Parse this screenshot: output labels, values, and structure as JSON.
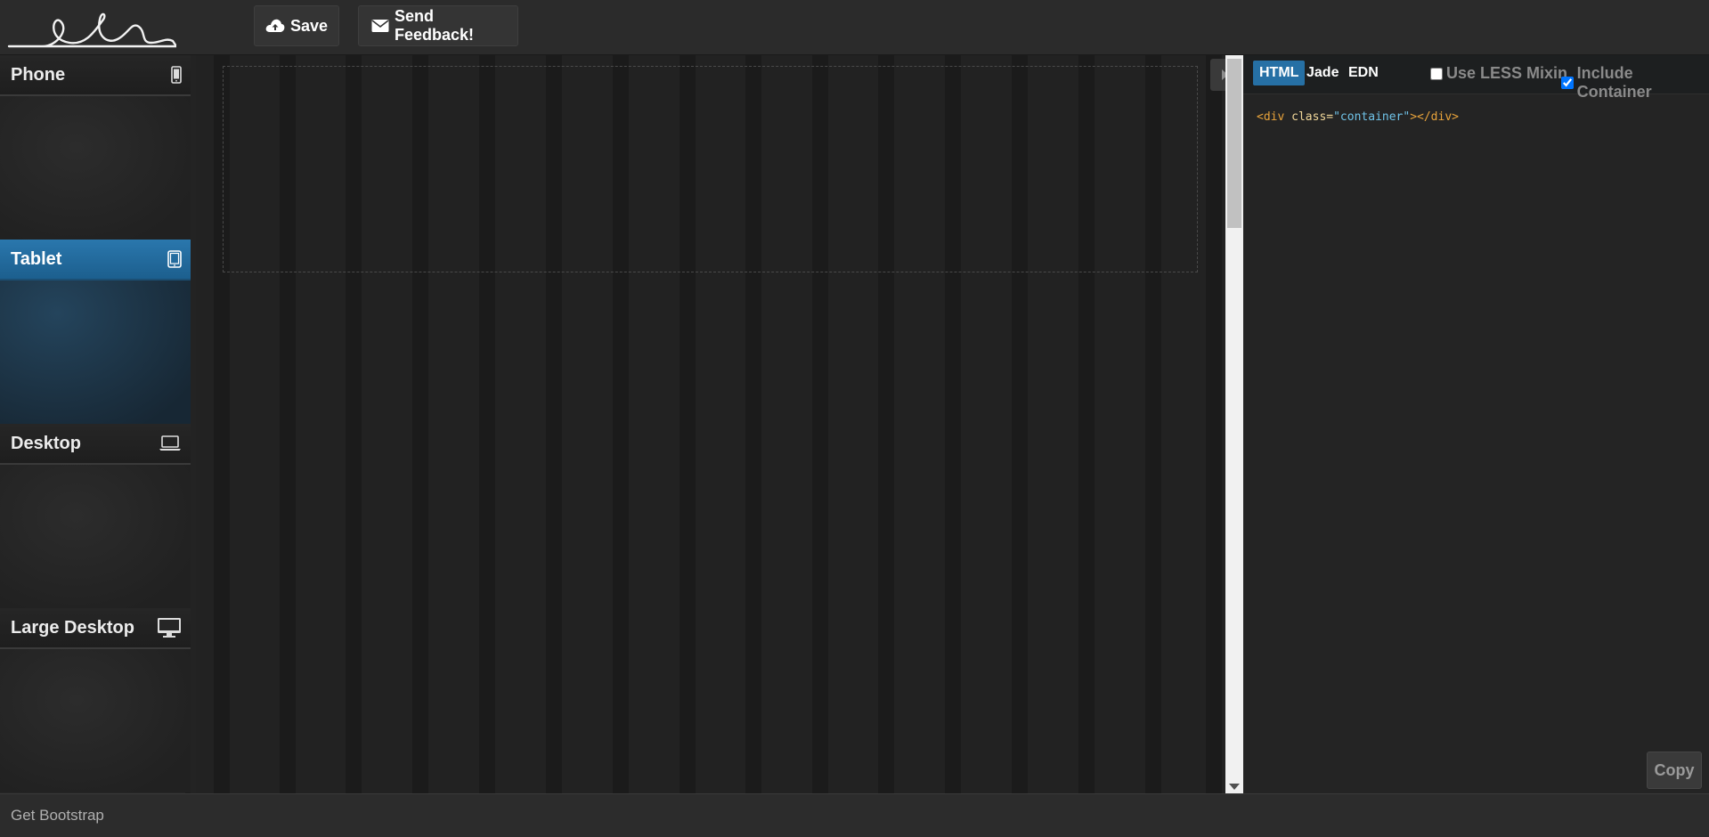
{
  "toolbar": {
    "logo_text": "shoelace",
    "save_label": "Save",
    "feedback_label": "Send Feedback!"
  },
  "sidebar": {
    "devices": [
      {
        "label": "Phone",
        "icon": "phone-icon"
      },
      {
        "label": "Tablet",
        "icon": "tablet-icon",
        "active": true
      },
      {
        "label": "Desktop",
        "icon": "laptop-icon"
      },
      {
        "label": "Large Desktop",
        "icon": "monitor-icon"
      }
    ]
  },
  "code_panel": {
    "tabs": [
      {
        "label": "HTML",
        "active": true
      },
      {
        "label": "Jade"
      },
      {
        "label": "EDN"
      }
    ],
    "options": {
      "use_less_mixin": {
        "label": "Use LESS Mixin",
        "checked": false
      },
      "include_container": {
        "label": "Include Container",
        "checked": true
      }
    },
    "code": {
      "open_tag": "<div",
      "attr_name": " class=",
      "attr_value": "\"container\"",
      "close": "></div>"
    },
    "copy_label": "Copy"
  },
  "footer": {
    "link_label": "Get Bootstrap"
  },
  "colors": {
    "accent": "#2670a5",
    "background": "#232323"
  }
}
